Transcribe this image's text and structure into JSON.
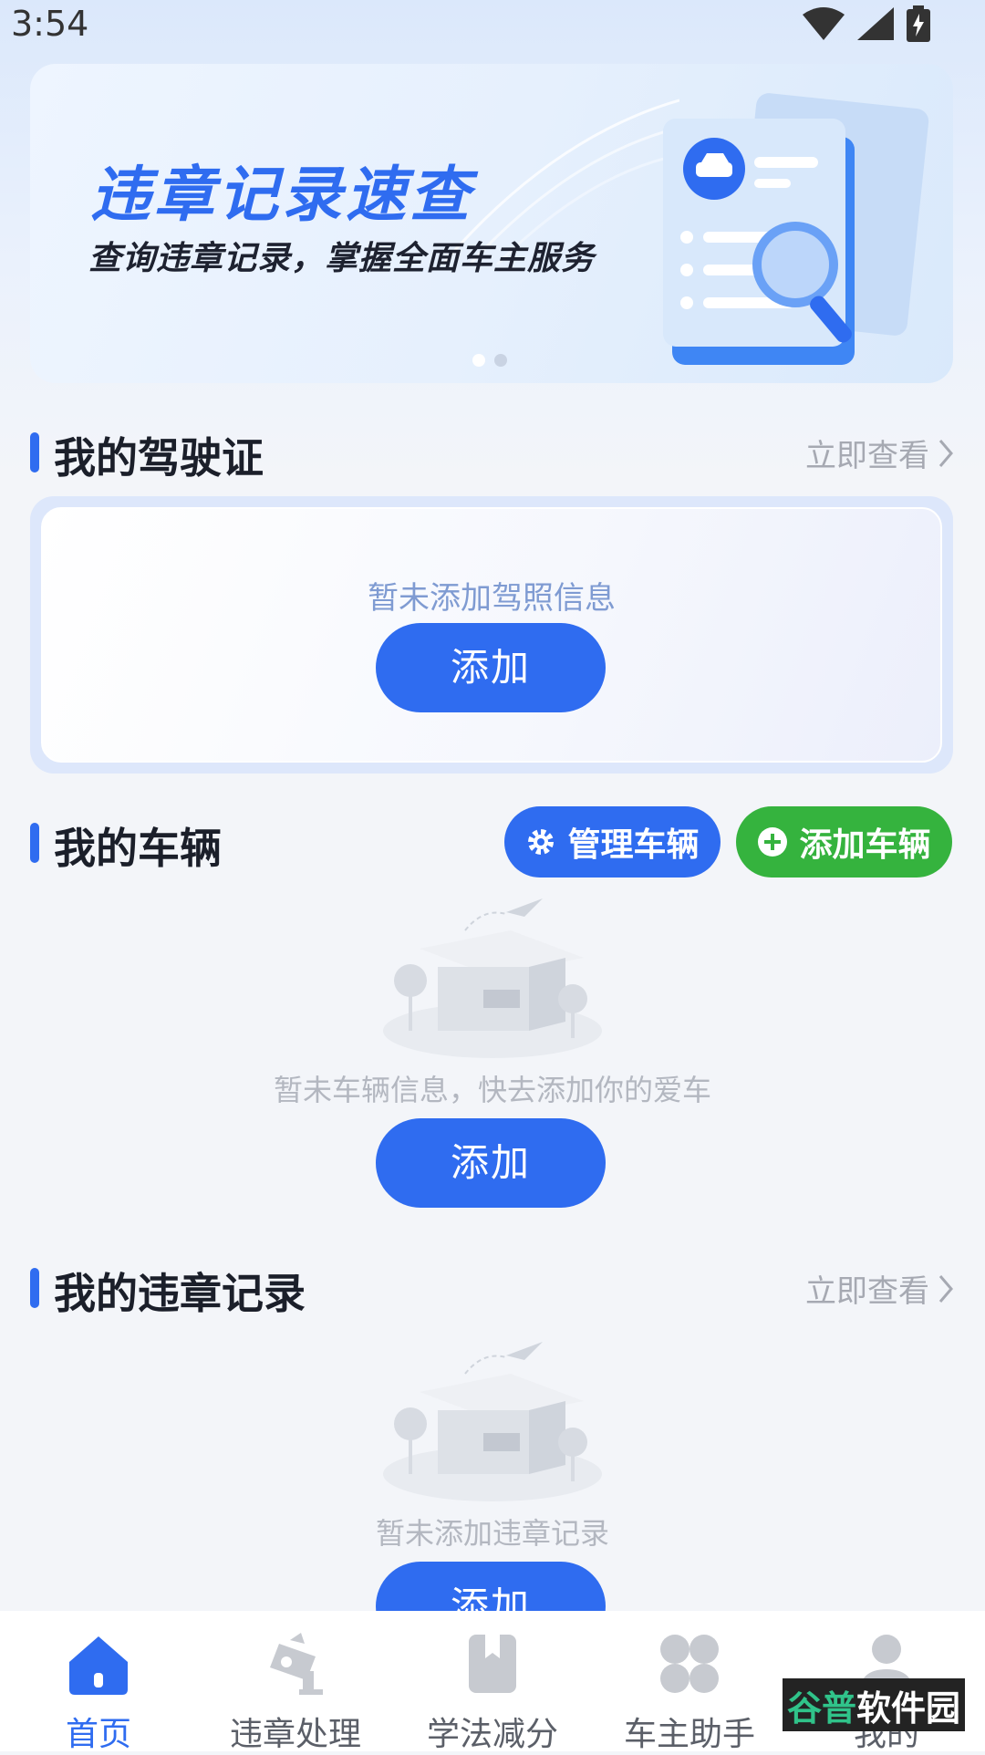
{
  "status_bar": {
    "time": "3:54"
  },
  "banner": {
    "title": "违章记录速查",
    "subtitle": "查询违章记录，掌握全面车主服务"
  },
  "license_section": {
    "title": "我的驾驶证",
    "link": "立即查看",
    "empty_text": "暂未添加驾照信息",
    "add_label": "添加"
  },
  "vehicle_section": {
    "title": "我的车辆",
    "manage_label": "管理车辆",
    "add_vehicle_label": "添加车辆",
    "empty_text": "暂未车辆信息，快去添加你的爱车",
    "add_label": "添加"
  },
  "violation_section": {
    "title": "我的违章记录",
    "link": "立即查看",
    "empty_text": "暂未添加违章记录",
    "add_label": "添加"
  },
  "bottom_nav": {
    "items": [
      {
        "label": "首页",
        "icon": "home-icon",
        "active": true
      },
      {
        "label": "违章处理",
        "icon": "camera-icon",
        "active": false
      },
      {
        "label": "学法减分",
        "icon": "book-icon",
        "active": false
      },
      {
        "label": "车主助手",
        "icon": "clover-icon",
        "active": false
      },
      {
        "label": "我的",
        "icon": "user-icon",
        "active": false
      }
    ]
  },
  "watermark": {
    "part1": "谷普",
    "part2": "软件园"
  },
  "colors": {
    "accent": "#2f6cf0",
    "green": "#35b33e",
    "muted": "#a6a9b2"
  }
}
